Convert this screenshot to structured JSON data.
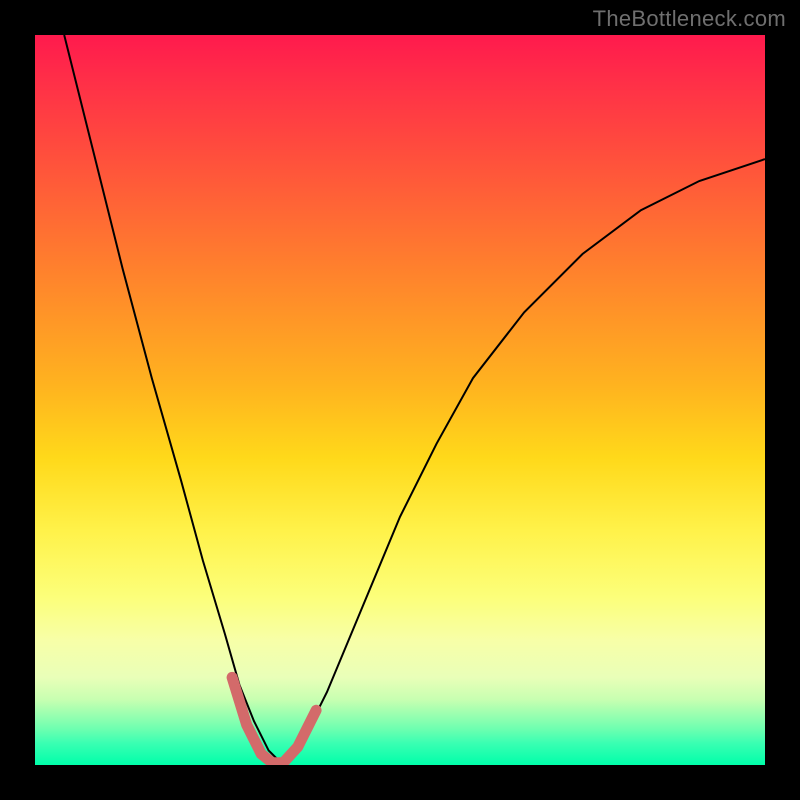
{
  "watermark": {
    "text": "TheBottleneck.com"
  },
  "chart_data": {
    "type": "line",
    "title": "",
    "xlabel": "",
    "ylabel": "",
    "xlim": [
      0,
      100
    ],
    "ylim": [
      0,
      100
    ],
    "axes_visible": false,
    "grid": false,
    "background": "rainbow-vertical-gradient",
    "series": [
      {
        "name": "curve",
        "color": "#000000",
        "stroke_width": 2,
        "x": [
          4,
          8,
          12,
          16,
          20,
          23,
          26,
          28,
          30,
          32,
          34,
          36,
          40,
          45,
          50,
          55,
          60,
          67,
          75,
          83,
          91,
          100
        ],
        "values": [
          100,
          84,
          68,
          53,
          39,
          28,
          18,
          11,
          6,
          2,
          0,
          2,
          10,
          22,
          34,
          44,
          53,
          62,
          70,
          76,
          80,
          83
        ]
      },
      {
        "name": "highlight",
        "color": "#d36a6a",
        "stroke_width": 11,
        "linecap": "round",
        "x": [
          27,
          29,
          31,
          32.5,
          34,
          36,
          38.5
        ],
        "values": [
          12,
          5.5,
          1.5,
          0.3,
          0.3,
          2.5,
          7.5
        ]
      }
    ],
    "annotations": []
  }
}
